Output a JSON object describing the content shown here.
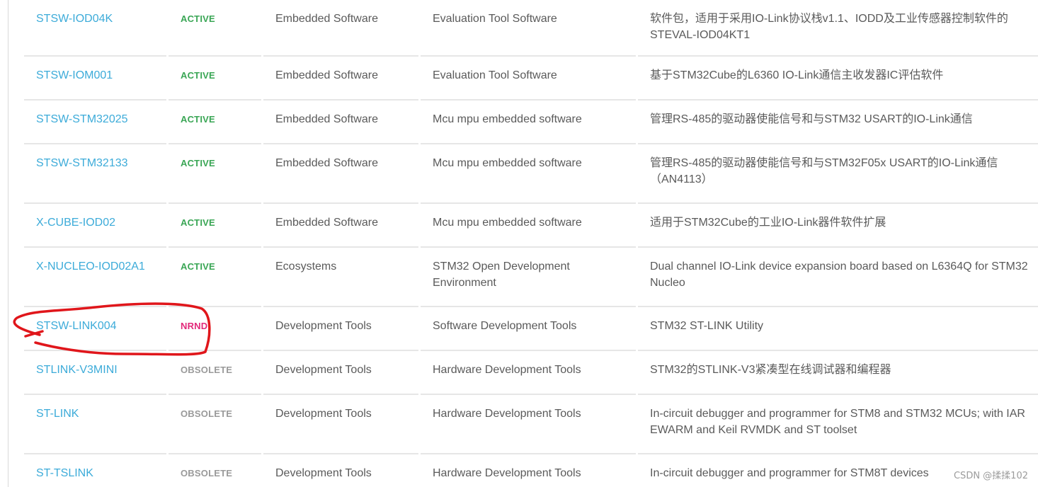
{
  "table": {
    "rows": [
      {
        "part": "STSW-IOD04K",
        "status": "ACTIVE",
        "status_kind": "active",
        "category": "Embedded Software",
        "subcategory": "Evaluation Tool Software",
        "description": "软件包，适用于采用IO-Link协议栈v1.1、IODD及工业传感器控制软件的STEVAL-IOD04KT1",
        "size": "r-first"
      },
      {
        "part": "STSW-IOM001",
        "status": "ACTIVE",
        "status_kind": "active",
        "category": "Embedded Software",
        "subcategory": "Evaluation Tool Software",
        "description": "基于STM32Cube的L6360 IO-Link通信主收发器IC评估软件",
        "size": "r-one"
      },
      {
        "part": "STSW-STM32025",
        "status": "ACTIVE",
        "status_kind": "active",
        "category": "Embedded Software",
        "subcategory": "Mcu mpu embedded software",
        "description": "管理RS-485的驱动器使能信号和与STM32 USART的IO-Link通信",
        "size": "r-one"
      },
      {
        "part": "STSW-STM32133",
        "status": "ACTIVE",
        "status_kind": "active",
        "category": "Embedded Software",
        "subcategory": "Mcu mpu embedded software",
        "description": "管理RS-485的驱动器使能信号和与STM32F05x USART的IO-Link通信（AN4113）",
        "size": "r-two"
      },
      {
        "part": "X-CUBE-IOD02",
        "status": "ACTIVE",
        "status_kind": "active",
        "category": "Embedded Software",
        "subcategory": "Mcu mpu embedded software",
        "description": "适用于STM32Cube的工业IO-Link器件软件扩展",
        "size": "r-one"
      },
      {
        "part": "X-NUCLEO-IOD02A1",
        "status": "ACTIVE",
        "status_kind": "active",
        "category": "Ecosystems",
        "subcategory": "STM32 Open Development Environment",
        "description": "Dual channel IO-Link device expansion board based on L6364Q for STM32 Nucleo",
        "size": "r-two"
      },
      {
        "part": "STSW-LINK004",
        "status": "NRND",
        "status_kind": "nrnd",
        "category": "Development Tools",
        "subcategory": "Software Development Tools",
        "description": "STM32 ST-LINK Utility",
        "size": "r-one"
      },
      {
        "part": "STLINK-V3MINI",
        "status": "OBSOLETE",
        "status_kind": "obsolete",
        "category": "Development Tools",
        "subcategory": "Hardware Development Tools",
        "description": "STM32的STLINK-V3紧凑型在线调试器和编程器",
        "size": "r-one"
      },
      {
        "part": "ST-LINK",
        "status": "OBSOLETE",
        "status_kind": "obsolete",
        "category": "Development Tools",
        "subcategory": "Hardware Development Tools",
        "description": "In-circuit debugger and programmer for STM8 and STM32 MCUs; with IAR EWARM and Keil RVMDK and ST toolset",
        "size": "r-two"
      },
      {
        "part": "ST-TSLINK",
        "status": "OBSOLETE",
        "status_kind": "obsolete",
        "category": "Development Tools",
        "subcategory": "Hardware Development Tools",
        "description": "In-circuit debugger and programmer for STM8T devices",
        "size": "r-last"
      }
    ]
  },
  "colors": {
    "link": "#3cabd9",
    "active": "#3aa655",
    "nrnd": "#e2297a",
    "obsolete": "#9a9a9a",
    "annotation": "#e0161b"
  },
  "annotation": {
    "target_row_part": "STSW-LINK004",
    "shape": "hand-drawn-circle"
  },
  "watermark": {
    "text": "CSDN @揉揉102"
  }
}
